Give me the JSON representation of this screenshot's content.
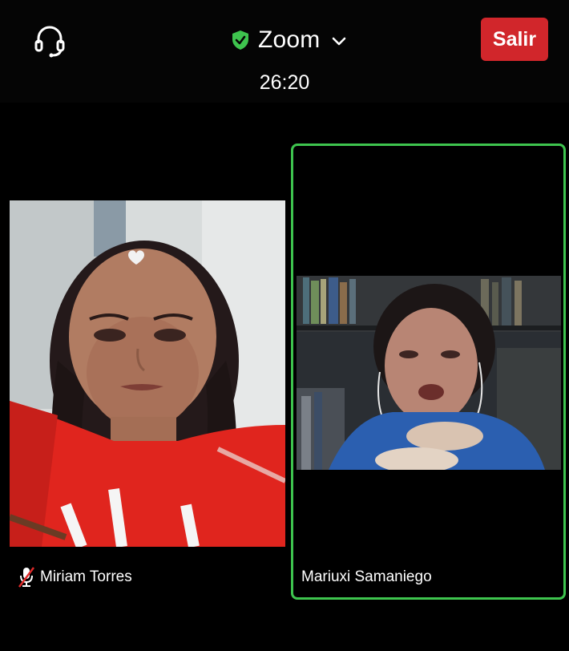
{
  "header": {
    "app_title": "Zoom",
    "timer": "26:20",
    "leave_label": "Salir",
    "icons": [
      "headset-icon",
      "shield-check-icon",
      "chevron-down-icon"
    ]
  },
  "participants": [
    {
      "name": "Miriam Torres",
      "muted": true
    },
    {
      "name": "Mariuxi Samaniego",
      "muted": false,
      "active_speaker": true
    }
  ],
  "colors": {
    "background": "#000000",
    "leave_button": "#d1262b",
    "active_speaker_border": "#3ec44e",
    "secure_shield": "#3ec44e"
  }
}
